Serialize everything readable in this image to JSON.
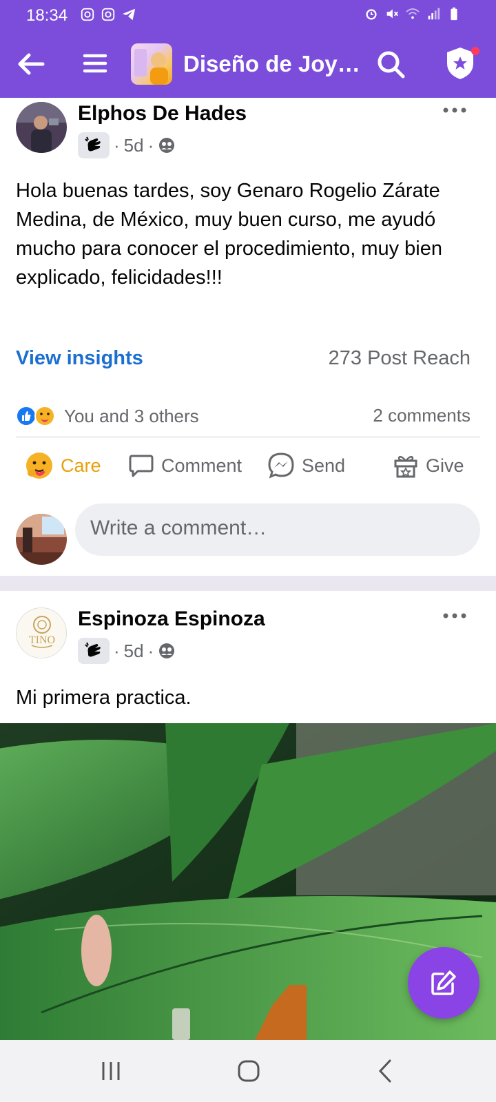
{
  "status_bar": {
    "time": "18:34",
    "left_icons": [
      "instagram-icon",
      "instagram-icon",
      "telegram-icon"
    ],
    "right_icons": [
      "alarm-icon",
      "mute-icon",
      "wifi-icon",
      "signal-icon",
      "battery-icon"
    ]
  },
  "app_bar": {
    "title": "Diseño de Joy…",
    "accent_color": "#7c4ddb"
  },
  "posts": [
    {
      "author": "Elphos De Hades",
      "time": "5d",
      "body": "Hola buenas tardes, soy Genaro Rogelio Zárate Medina, de México, muy buen curso, me ayudó mucho para conocer el procedimiento, muy bien explicado, felicidades!!!",
      "insights_label": "View insights",
      "reach": "273 Post Reach",
      "reactions_text": "You and 3 others",
      "comments_count": "2 comments",
      "actions": {
        "care": "Care",
        "comment": "Comment",
        "send": "Send",
        "give": "Give"
      },
      "comment_placeholder": "Write a comment…"
    },
    {
      "author": "Espinoza Espinoza",
      "time": "5d",
      "avatar_text": "TINO",
      "body": "Mi primera practica."
    }
  ],
  "colors": {
    "link": "#1b6fd1",
    "care": "#e8a10e",
    "fab": "#8a44e6"
  }
}
